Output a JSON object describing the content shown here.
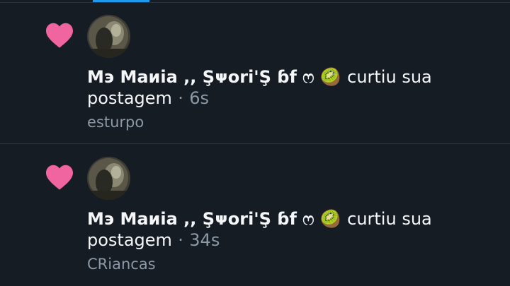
{
  "notifications": [
    {
      "user_name": "Mэ Maиia ,, Şᴪori'Ş ɓf ෆ",
      "emoji": "🥝",
      "action": "curtiu sua",
      "action_cont": "postagem",
      "separator": "·",
      "time": "6s",
      "post_preview": "esturpo"
    },
    {
      "user_name": "Mэ Maиia ,, Şᴪori'Ş ɓf ෆ",
      "emoji": "🥝",
      "action": "curtiu sua",
      "action_cont": "postagem",
      "separator": "·",
      "time": "34s",
      "post_preview": "CRiancas"
    }
  ],
  "colors": {
    "background": "#161c24",
    "heart": "#f0649f",
    "accent": "#1d9bf0",
    "secondary_text": "#8b98a5"
  },
  "icons": {
    "like": "heart-icon",
    "avatar": "user-avatar"
  }
}
